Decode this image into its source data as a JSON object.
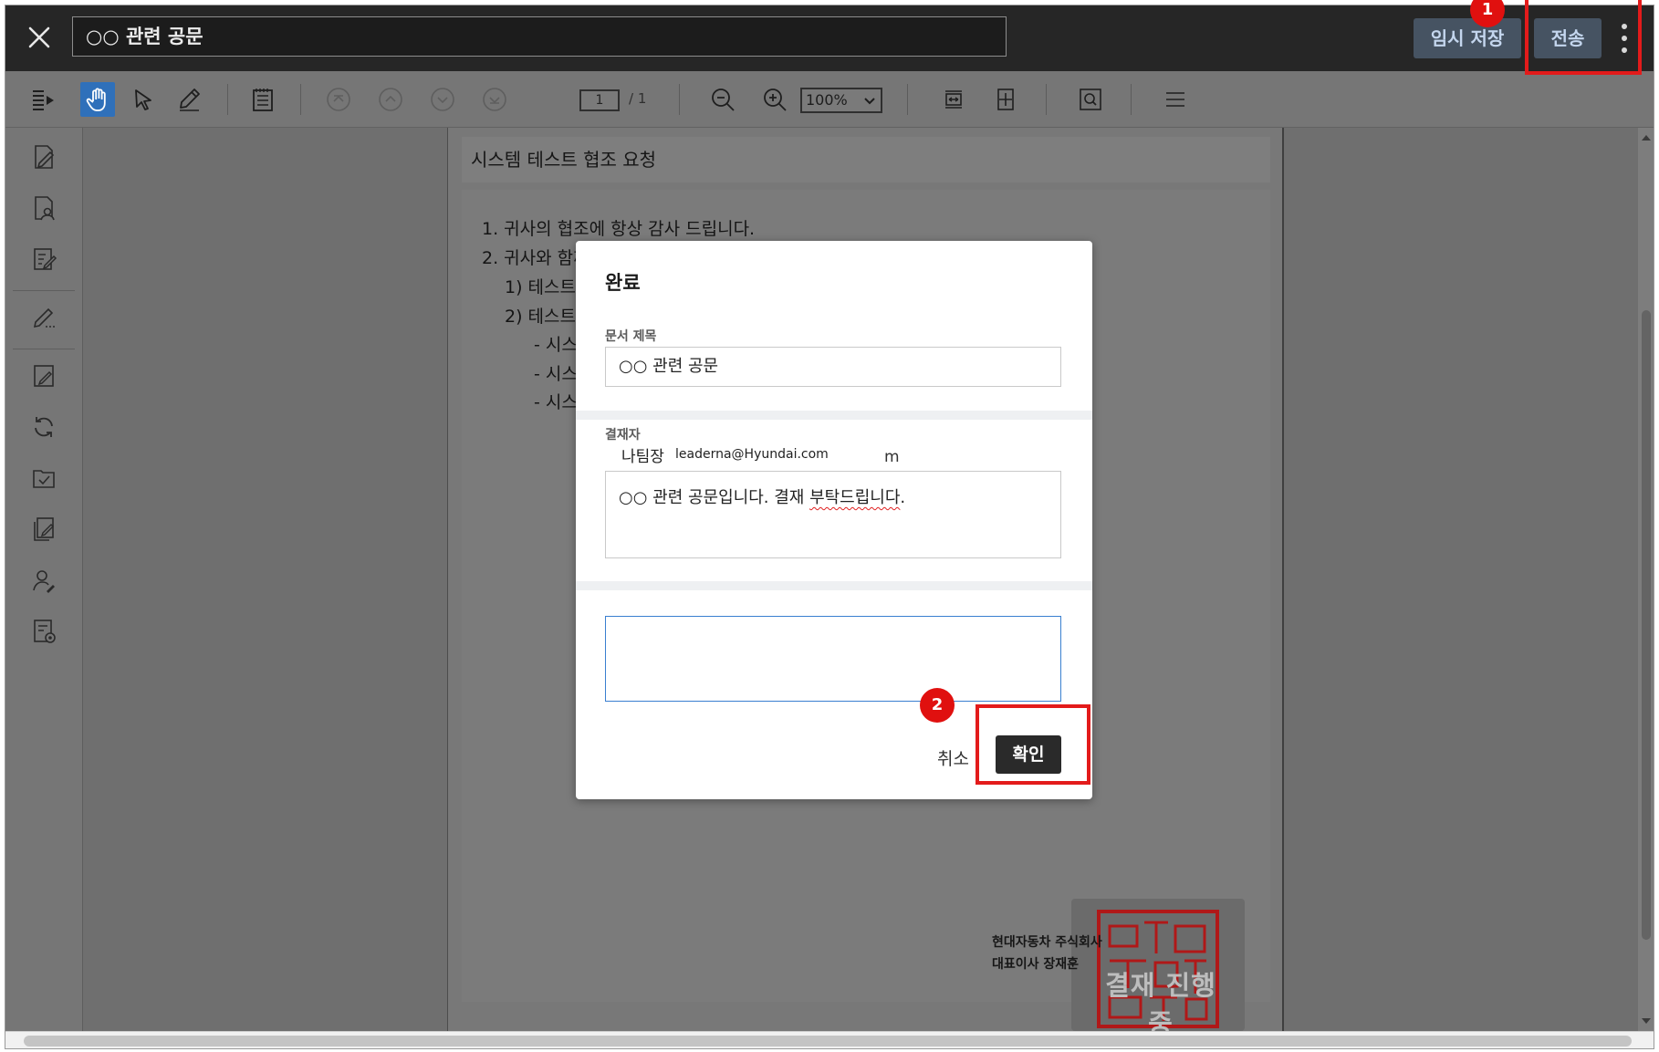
{
  "window": {
    "document_title": "○○ 관련 공문",
    "temp_save_label": "임시 저장",
    "send_label": "전송"
  },
  "toolbar": {
    "current_page": "1",
    "page_total": "/ 1",
    "zoom": "100%"
  },
  "document": {
    "title": "시스템 테스트 협조 요청",
    "lines": [
      "1. 귀사의 협조에 항상 감사 드립니다.",
      "2. 귀사와 함께",
      "1) 테스트",
      "2) 테스트",
      "- 시스",
      "- 시스",
      "- 시스"
    ],
    "company": "현대자동차 주식회사",
    "ceo": "대표이사 장재훈",
    "seal_caption": "결재 진행 중"
  },
  "dialog": {
    "title": "완료",
    "doc_title_label": "문서 제목",
    "doc_title_value": "○○ 관련 공문",
    "approver_label": "결재자",
    "approver_name": "나팀장",
    "approver_email": "leaderna@Hyundai.com",
    "approver_trail": "m",
    "message_prefix": "○○ 관련 공문입니다. 결재 ",
    "message_spell": "부탁드립니다",
    "message_suffix": ".",
    "comment_value": "",
    "cancel_label": "취소",
    "confirm_label": "확인"
  },
  "annotations": {
    "callout_1": "1",
    "callout_2": "2",
    "highlight_color": "#e31b1b"
  },
  "colors": {
    "topbar": "#262626",
    "active_tool": "#2f70ba",
    "top_button": "#465362",
    "confirm_button": "#2a2a2a"
  },
  "icons": {
    "close": "close-icon",
    "more": "more-vertical-icon",
    "hand": "hand-icon",
    "select": "cursor-arrow-icon",
    "pen": "pencil-icon",
    "notes": "notes-icon",
    "first": "first-page-icon",
    "prev": "previous-page-icon",
    "next": "next-page-icon",
    "last": "last-page-icon",
    "zoom_out": "zoom-out-icon",
    "zoom_in": "zoom-in-icon",
    "fit_width": "fit-width-icon",
    "fit_page": "fit-page-icon",
    "search": "search-icon",
    "menu": "menu-icon"
  }
}
